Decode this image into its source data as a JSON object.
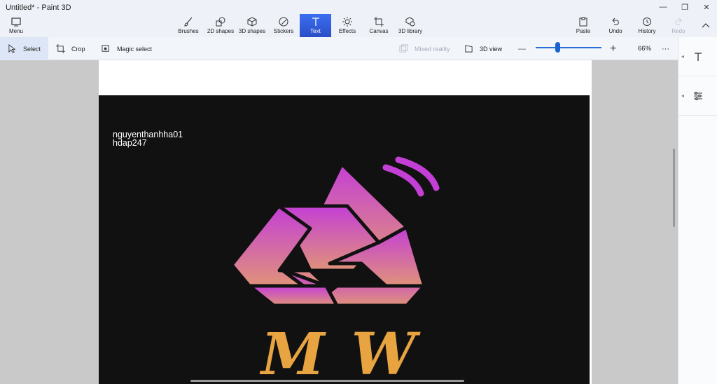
{
  "window": {
    "title": "Untitled* - Paint 3D",
    "minimize": "—",
    "restore": "❐",
    "close": "✕"
  },
  "ribbon": {
    "menu": "Menu",
    "tools": [
      {
        "label": "Brushes",
        "icon": "brush-icon"
      },
      {
        "label": "2D shapes",
        "icon": "2d-shapes-icon"
      },
      {
        "label": "3D shapes",
        "icon": "3d-shapes-icon"
      },
      {
        "label": "Stickers",
        "icon": "stickers-icon"
      },
      {
        "label": "Text",
        "icon": "text-icon",
        "active": true
      },
      {
        "label": "Effects",
        "icon": "effects-icon"
      },
      {
        "label": "Canvas",
        "icon": "canvas-icon"
      },
      {
        "label": "3D library",
        "icon": "3d-library-icon"
      }
    ],
    "paste": "Paste",
    "undo": "Undo",
    "history": "History",
    "redo": "Redo"
  },
  "subbar": {
    "select": "Select",
    "crop": "Crop",
    "magic_select": "Magic select",
    "mixed_reality": "Mixed reality",
    "view_3d": "3D view",
    "zoom_minus": "—",
    "zoom_plus": "+",
    "zoom": "66%",
    "more": "···",
    "zoom_level": 0.33
  },
  "artwork": {
    "line1": "nguyenthanhha01",
    "line2": "hdap247",
    "logo_letters": "MW",
    "logo_gradient_top": "#c43fd6",
    "logo_gradient_bottom": "#e0927a",
    "letters_color": "#e8a440"
  },
  "colors": {
    "accent": "#2b5fe0",
    "canvas_bg": "#121112"
  }
}
